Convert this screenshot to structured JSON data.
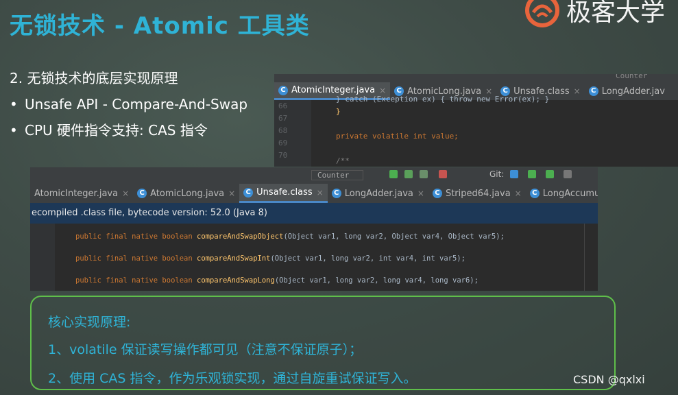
{
  "slide": {
    "title": "无锁技术 - Atomic 工具类",
    "logo_text": "极客大学",
    "bullets": [
      {
        "marker": "",
        "text": "2. 无锁技术的底层实现原理"
      },
      {
        "marker": "•",
        "text": "Unsafe API - Compare-And-Swap"
      },
      {
        "marker": "•",
        "text": "CPU 硬件指令支持: CAS 指令"
      }
    ]
  },
  "ide_top": {
    "tabs": [
      {
        "label": "AtomicInteger.java",
        "active": true
      },
      {
        "label": "AtomicLong.java",
        "active": false
      },
      {
        "label": "Unsafe.class",
        "active": false
      },
      {
        "label": "LongAdder.jav",
        "active": false
      }
    ],
    "header_hint": "Counter",
    "line_numbers": [
      "66",
      "67",
      "68",
      "69",
      "70"
    ],
    "code_lines": [
      "} catch (Exception ex) { throw new Error(ex); }",
      "}",
      "",
      "private volatile int value;",
      "",
      "/**"
    ]
  },
  "ide_bottom": {
    "run_config": "Counter",
    "git_label": "Git:",
    "tabs": [
      {
        "label": "AtomicInteger.java",
        "active": false
      },
      {
        "label": "AtomicLong.java",
        "active": false
      },
      {
        "label": "Unsafe.class",
        "active": true
      },
      {
        "label": "LongAdder.java",
        "active": false
      },
      {
        "label": "Striped64.java",
        "active": false
      },
      {
        "label": "LongAccumulator.ja",
        "active": false
      }
    ],
    "info": "ecompiled .class file, bytecode version: 52.0 (Java 8)",
    "methods": [
      {
        "modifiers": "public final native boolean",
        "name": "compareAndSwapObject",
        "params": "(Object var1, long var2, Object var4, Object var5);"
      },
      {
        "modifiers": "public final native boolean",
        "name": "compareAndSwapInt",
        "params": "(Object var1, long var2, int var4, int var5);"
      },
      {
        "modifiers": "public final native boolean",
        "name": "compareAndSwapLong",
        "params": "(Object var1, long var2, long var4, long var6);"
      }
    ]
  },
  "principle_box": {
    "heading": "核心实现原理:",
    "item1": "1、volatile 保证读写操作都可见（注意不保证原子）；",
    "item2": "2、使用 CAS 指令，作为乐观锁实现，通过自旋重试保证写入。"
  },
  "watermark": "CSDN @qxlxi",
  "colors": {
    "title": "#2fb3d6",
    "box_border": "#5fbf4a",
    "keyword": "#cc7832",
    "method": "#ffc66d",
    "info_bar": "#1d3857"
  }
}
